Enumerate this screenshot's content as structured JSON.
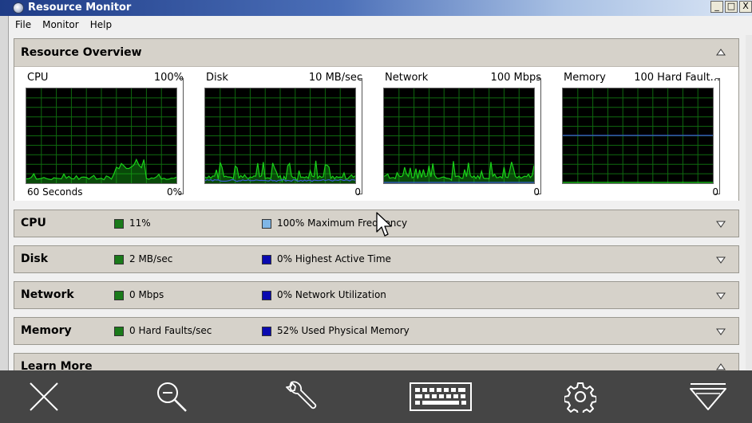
{
  "window": {
    "title": "Resource Monitor",
    "buttons": [
      "_",
      "□",
      "X"
    ]
  },
  "menu": [
    "File",
    "Monitor",
    "Help"
  ],
  "overview": {
    "title": "Resource Overview",
    "graphs": [
      {
        "name": "CPU",
        "max": "100%",
        "min": "60 Seconds",
        "zero": "0%"
      },
      {
        "name": "Disk",
        "max": "10 MB/sec",
        "min": "",
        "zero": "0"
      },
      {
        "name": "Network",
        "max": "100 Mbps",
        "min": "",
        "zero": "0"
      },
      {
        "name": "Memory",
        "max": "100 Hard Fault...",
        "min": "",
        "zero": "0"
      }
    ]
  },
  "rows": [
    {
      "title": "CPU",
      "value1": "11%",
      "value2": "100% Maximum Frequency",
      "swatch2": "#7fb6e6"
    },
    {
      "title": "Disk",
      "value1": "2 MB/sec",
      "value2": "0% Highest Active Time",
      "swatch2": "#0a0ab0"
    },
    {
      "title": "Network",
      "value1": "0 Mbps",
      "value2": "0% Network Utilization",
      "swatch2": "#0a0ab0"
    },
    {
      "title": "Memory",
      "value1": "0 Hard Faults/sec",
      "value2": "52% Used Physical Memory",
      "swatch2": "#0a0ab0"
    },
    {
      "title": "Learn More"
    }
  ],
  "colors": {
    "graph_green": "#19d219",
    "graph_blue": "#3b5bd8",
    "grid": "#0f6a0f",
    "toolbar": "#454545"
  },
  "toolbar_icons": [
    "close-icon",
    "zoom-out-icon",
    "wrench-icon",
    "keyboard-icon",
    "gear-icon",
    "dropdown-icon"
  ]
}
